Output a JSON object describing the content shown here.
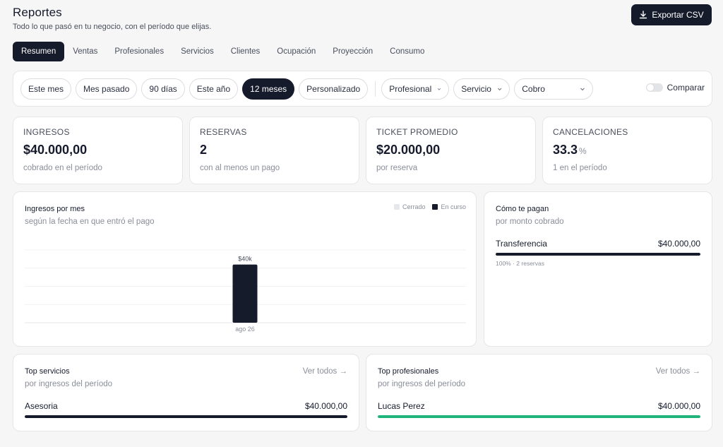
{
  "header": {
    "title": "Reportes",
    "subtitle": "Todo lo que pasó en tu negocio, con el período que elijas.",
    "export_label": "Exportar CSV"
  },
  "tabs": [
    {
      "label": "Resumen",
      "active": true
    },
    {
      "label": "Ventas"
    },
    {
      "label": "Profesionales"
    },
    {
      "label": "Servicios"
    },
    {
      "label": "Clientes"
    },
    {
      "label": "Ocupación"
    },
    {
      "label": "Proyección"
    },
    {
      "label": "Consumo"
    }
  ],
  "filters": {
    "periods": [
      {
        "label": "Este mes"
      },
      {
        "label": "Mes pasado"
      },
      {
        "label": "90 días"
      },
      {
        "label": "Este año"
      },
      {
        "label": "12 meses",
        "active": true
      },
      {
        "label": "Personalizado"
      }
    ],
    "dropdowns": [
      {
        "label": "Profesional"
      },
      {
        "label": "Servicio"
      },
      {
        "label": "Cobro"
      }
    ],
    "compare_label": "Comparar",
    "compare_on": false
  },
  "kpis": [
    {
      "label": "INGRESOS",
      "value": "$40.000,00",
      "unit": "",
      "sub": "cobrado en el período"
    },
    {
      "label": "RESERVAS",
      "value": "2",
      "unit": "",
      "sub": "con al menos un pago"
    },
    {
      "label": "TICKET PROMEDIO",
      "value": "$20.000,00",
      "unit": "",
      "sub": "por reserva"
    },
    {
      "label": "CANCELACIONES",
      "value": "33.3",
      "unit": "%",
      "sub": "1 en el período"
    }
  ],
  "income_chart": {
    "title": "Ingresos por mes",
    "subtitle": "según la fecha en que entró el pago",
    "legend": [
      {
        "label": "Cerrado",
        "color": "#e6e7ea"
      },
      {
        "label": "En curso",
        "color": "#161b2c"
      }
    ]
  },
  "chart_data": {
    "type": "bar",
    "categories": [
      "ago 26"
    ],
    "values": [
      40000
    ],
    "value_labels": [
      "$40k"
    ],
    "bar_color": "#161b2c",
    "ylim": [
      0,
      50000
    ],
    "grid": true
  },
  "payments": {
    "title": "Cómo te pagan",
    "subtitle": "por monto cobrado",
    "items": [
      {
        "name": "Transferencia",
        "amount": "$40.000,00",
        "detail": "100% · 2 reservas",
        "share": 1.0,
        "color": "#161b2c"
      }
    ]
  },
  "top_services": {
    "title": "Top servicios",
    "subtitle": "por ingresos del período",
    "link": "Ver todos →",
    "items": [
      {
        "name": "Asesoria",
        "amount": "$40.000,00",
        "share": 1.0,
        "color": "#161b2c"
      }
    ]
  },
  "top_professionals": {
    "title": "Top profesionales",
    "subtitle": "por ingresos del período",
    "link": "Ver todos →",
    "items": [
      {
        "name": "Lucas Perez",
        "amount": "$40.000,00",
        "share": 1.0,
        "color": "#1fb57a"
      }
    ]
  }
}
